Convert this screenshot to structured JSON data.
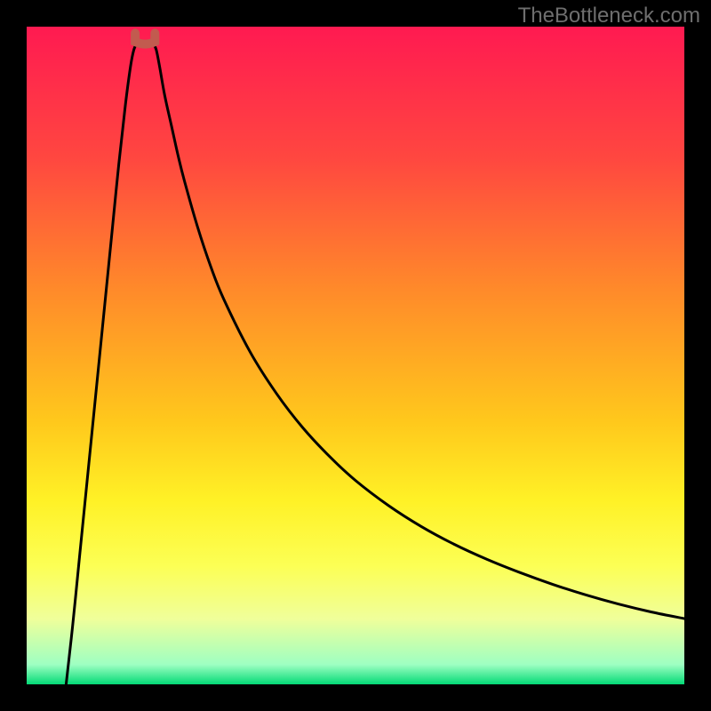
{
  "watermark": "TheBottleneck.com",
  "chart_data": {
    "type": "line",
    "title": "",
    "xlabel": "",
    "ylabel": "",
    "xlim": [
      0,
      100
    ],
    "ylim": [
      0,
      100
    ],
    "grid": false,
    "legend": false,
    "background": {
      "type": "vertical-gradient",
      "stops": [
        {
          "y": 0,
          "color": "#ff1a51"
        },
        {
          "y": 20,
          "color": "#ff4740"
        },
        {
          "y": 40,
          "color": "#ff8a2a"
        },
        {
          "y": 60,
          "color": "#ffc81c"
        },
        {
          "y": 72,
          "color": "#fff126"
        },
        {
          "y": 82,
          "color": "#fcff55"
        },
        {
          "y": 90,
          "color": "#f0ff9a"
        },
        {
          "y": 97,
          "color": "#9effc2"
        },
        {
          "y": 100,
          "color": "#03da76"
        }
      ]
    },
    "series": [
      {
        "name": "left-branch",
        "color": "#000000",
        "x": [
          6,
          7,
          8,
          9,
          10,
          11,
          12,
          13,
          14,
          15,
          15.8,
          16.3,
          16.7
        ],
        "y": [
          0,
          9,
          19,
          29,
          39,
          49,
          59,
          69,
          79,
          88,
          94,
          96.5,
          97.3
        ]
      },
      {
        "name": "right-branch",
        "color": "#000000",
        "x": [
          19.3,
          19.7,
          20.2,
          21,
          22,
          23,
          24,
          26,
          28,
          30,
          34,
          38,
          42,
          46,
          50,
          55,
          60,
          65,
          70,
          75,
          80,
          85,
          90,
          95,
          100
        ],
        "y": [
          97.3,
          96.5,
          94,
          89.5,
          85,
          80.5,
          76.5,
          69.5,
          63.5,
          58.5,
          50.5,
          44.2,
          39,
          34.7,
          31,
          27.2,
          24,
          21.3,
          19,
          17,
          15.2,
          13.6,
          12.2,
          11,
          10
        ]
      },
      {
        "name": "valley-marker",
        "color": "#c25b4f",
        "shape": "u",
        "x_center": 18,
        "y_center": 98,
        "width": 3.0,
        "height": 2.0
      }
    ]
  }
}
